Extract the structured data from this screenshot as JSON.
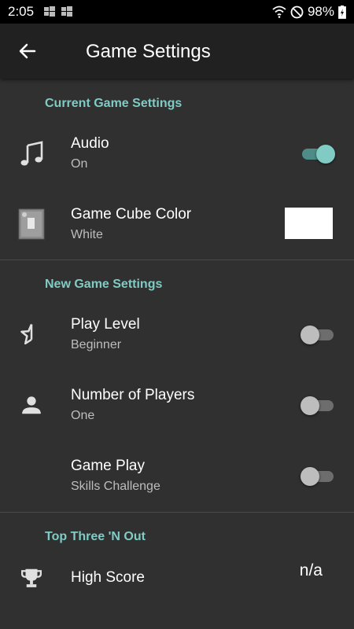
{
  "status_bar": {
    "time": "2:05",
    "battery": "98%"
  },
  "app_bar": {
    "title": "Game Settings",
    "back_icon": "arrow-left-icon"
  },
  "sections": {
    "current": {
      "header": "Current Game Settings",
      "audio": {
        "title": "Audio",
        "value": "On",
        "icon": "music-note-icon",
        "switch": "on"
      },
      "cube_color": {
        "title": "Game Cube Color",
        "value": "White",
        "icon": "game-cube-icon",
        "swatch_color": "#ffffff"
      }
    },
    "new_game": {
      "header": "New Game Settings",
      "play_level": {
        "title": "Play Level",
        "value": "Beginner",
        "icon": "star-half-icon",
        "switch": "off"
      },
      "players": {
        "title": "Number of Players",
        "value": "One",
        "icon": "person-icon",
        "switch": "off"
      },
      "game_play": {
        "title": "Game Play",
        "value": "Skills Challenge",
        "switch": "off"
      }
    },
    "top_three": {
      "header": "Top Three 'N Out",
      "high_score": {
        "title": "High Score",
        "value": "n/a",
        "icon": "trophy-icon"
      }
    }
  },
  "colors": {
    "accent": "#80cbc4",
    "background": "#303030",
    "app_bar": "#212121"
  }
}
